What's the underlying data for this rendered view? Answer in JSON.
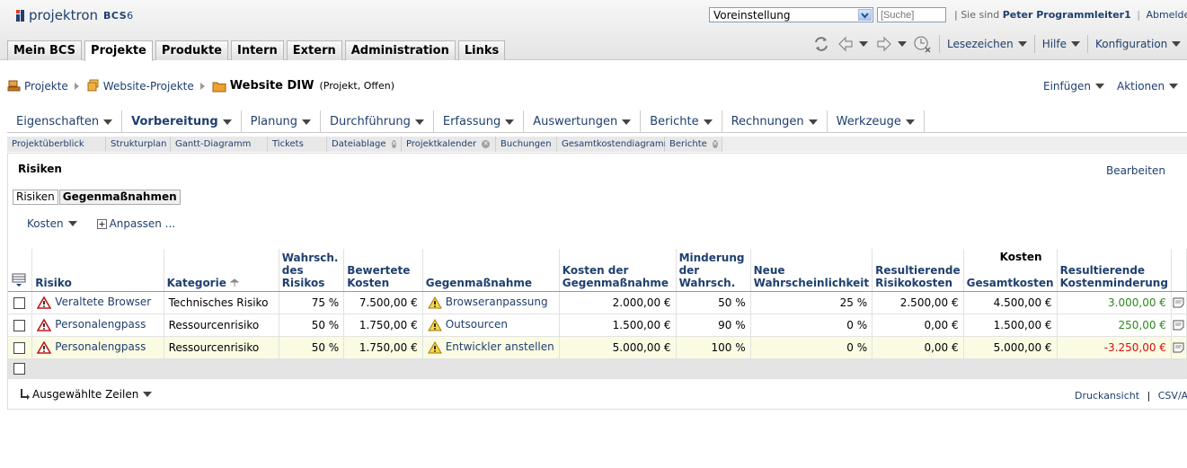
{
  "app": {
    "logo_text": "projektron",
    "logo_suffix": "BCS",
    "logo_version": "6"
  },
  "topbar": {
    "preset_value": "Voreinstellung",
    "search_placeholder": "[Suche]",
    "signed_in_prefix": "| Sie sind",
    "user_name": "Peter Programmleiter1",
    "logout_label": "Abmelden"
  },
  "main_tabs": [
    "Mein BCS",
    "Projekte",
    "Produkte",
    "Intern",
    "Extern",
    "Administration",
    "Links"
  ],
  "active_tab": "Projekte",
  "toolbar": {
    "bookmarks": "Lesezeichen",
    "help": "Hilfe",
    "config": "Konfiguration"
  },
  "breadcrumb": {
    "item1": "Projekte",
    "item2": "Website-Projekte",
    "current": "Website DIW",
    "current_meta": "(Projekt, Offen)"
  },
  "page_actions": {
    "insert": "Einfügen",
    "actions": "Aktionen"
  },
  "menubar": [
    "Eigenschaften",
    "Vorbereitung",
    "Planung",
    "Durchführung",
    "Erfassung",
    "Auswertungen",
    "Berichte",
    "Rechnungen",
    "Werkzeuge"
  ],
  "active_menu": "Vorbereitung",
  "subtabs": [
    {
      "label": "Projektüberblick",
      "closable": false
    },
    {
      "label": "Strukturplan",
      "closable": false
    },
    {
      "label": "Gantt-Diagramm",
      "closable": false
    },
    {
      "label": "Tickets",
      "closable": false
    },
    {
      "label": "Dateiablage",
      "closable": true
    },
    {
      "label": "Projektkalender",
      "closable": true
    },
    {
      "label": "Buchungen",
      "closable": false
    },
    {
      "label": "Gesamtkostendiagramm",
      "closable": false
    },
    {
      "label": "Berichte",
      "closable": true
    }
  ],
  "panel": {
    "title": "Risiken",
    "edit_label": "Bearbeiten",
    "view_tabs": [
      "Risiken",
      "Gegenmaßnahmen"
    ],
    "active_view": "Gegenmaßnahmen",
    "cost_filter": "Kosten",
    "customize": "Anpassen ...",
    "group_header": "Kosten",
    "columns": [
      "Risiko",
      "Kategorie",
      "Wahrsch. des Risikos",
      "Bewertete Kosten",
      "Gegenmaßnahme",
      "Kosten der Gegenmaßnahme",
      "Minderung der Wahrsch.",
      "Neue Wahrscheinlichkeit",
      "Resultierende Risikokosten",
      "Gesamtkosten",
      "Resultierende Kostenminderung"
    ],
    "rows": [
      {
        "risk": "Veraltete Browser",
        "category": "Technisches Risiko",
        "prob": "75 %",
        "cost": "7.500,00 €",
        "measure": "Browseranpassung",
        "measure_cost": "2.000,00 €",
        "reduction": "50 %",
        "new_prob": "25 %",
        "result_cost": "2.500,00 €",
        "total": "4.500,00 €",
        "saving": "3.000,00 €",
        "saving_color": "#2a8a1a"
      },
      {
        "risk": "Personalengpass",
        "category": "Ressourcenrisiko",
        "prob": "50 %",
        "cost": "1.750,00 €",
        "measure": "Outsourcen",
        "measure_cost": "1.500,00 €",
        "reduction": "90 %",
        "new_prob": "0 %",
        "result_cost": "0,00 €",
        "total": "1.500,00 €",
        "saving": "250,00 €",
        "saving_color": "#2a8a1a"
      },
      {
        "risk": "Personalengpass",
        "category": "Ressourcenrisiko",
        "prob": "50 %",
        "cost": "1.750,00 €",
        "measure": "Entwickler anstellen",
        "measure_cost": "5.000,00 €",
        "reduction": "100 %",
        "new_prob": "0 %",
        "result_cost": "0,00 €",
        "total": "5.000,00 €",
        "saving": "-3.250,00 €",
        "saving_color": "#d01010"
      }
    ],
    "selected_rows": "Ausgewählte Zeilen",
    "print_view": "Druckansicht",
    "csv": "CSV/Ansicht"
  }
}
